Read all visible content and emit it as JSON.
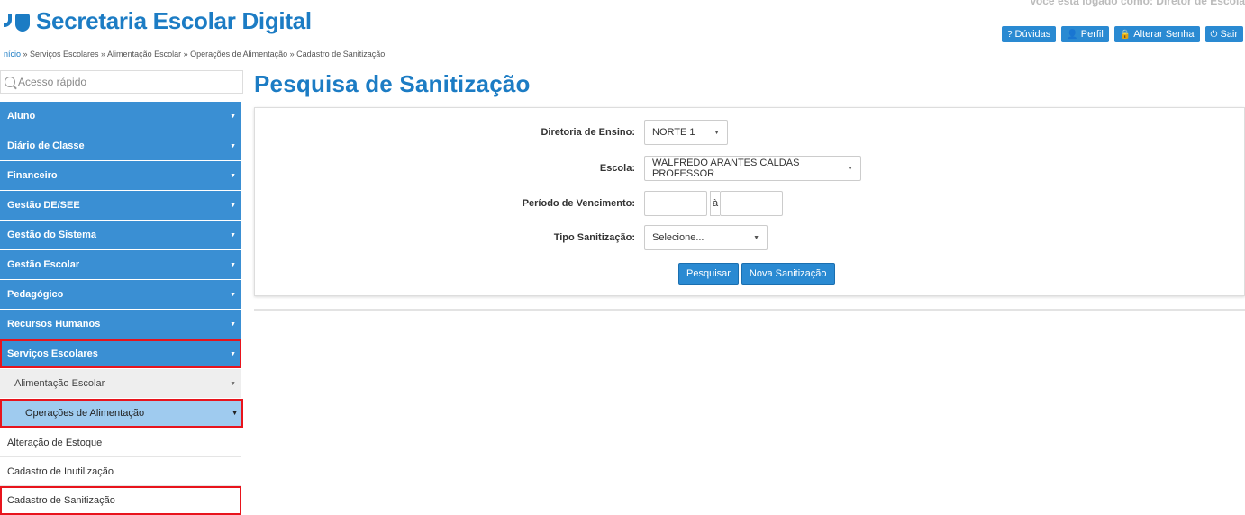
{
  "header": {
    "app_title": "Secretaria Escolar Digital",
    "logged_as": "Você está logado como: Diretor de Escola",
    "buttons": [
      {
        "icon": "question-icon",
        "glyph": "?",
        "label": "Dúvidas"
      },
      {
        "icon": "user-icon",
        "glyph": "👤",
        "label": "Perfil"
      },
      {
        "icon": "lock-icon",
        "glyph": "🔒",
        "label": "Alterar Senha"
      },
      {
        "icon": "power-icon",
        "glyph": "⏻",
        "label": "Sair"
      }
    ]
  },
  "breadcrumb": {
    "home": "nício",
    "rest": " » Serviços Escolares » Alimentação Escolar » Operações de Alimentação » Cadastro de Sanitização"
  },
  "sidebar": {
    "search_placeholder": "Acesso rápido",
    "items": [
      {
        "label": "Aluno"
      },
      {
        "label": "Diário de Classe"
      },
      {
        "label": "Financeiro"
      },
      {
        "label": "Gestão DE/SEE"
      },
      {
        "label": "Gestão do Sistema"
      },
      {
        "label": "Gestão Escolar"
      },
      {
        "label": "Pedagógico"
      },
      {
        "label": "Recursos Humanos"
      },
      {
        "label": "Serviços Escolares"
      }
    ],
    "sub_level1": "Alimentação Escolar",
    "sub_level2": "Operações de Alimentação",
    "leaves": [
      {
        "label": "Alteração de Estoque"
      },
      {
        "label": "Cadastro de Inutilização"
      },
      {
        "label": "Cadastro de Sanitização"
      }
    ]
  },
  "main": {
    "title": "Pesquisa de Sanitização",
    "form": {
      "diretoria_label": "Diretoria de Ensino:",
      "diretoria_value": "NORTE 1",
      "escola_label": "Escola:",
      "escola_value": "WALFREDO ARANTES CALDAS PROFESSOR",
      "periodo_label": "Período de Vencimento:",
      "periodo_sep": "à",
      "tipo_label": "Tipo Sanitização:",
      "tipo_value": "Selecione..."
    },
    "buttons": {
      "search": "Pesquisar",
      "new": "Nova Sanitização"
    }
  },
  "colors": {
    "brand": "#1c7cc4",
    "menu": "#3a8fd3",
    "highlight": "#e8141c"
  }
}
